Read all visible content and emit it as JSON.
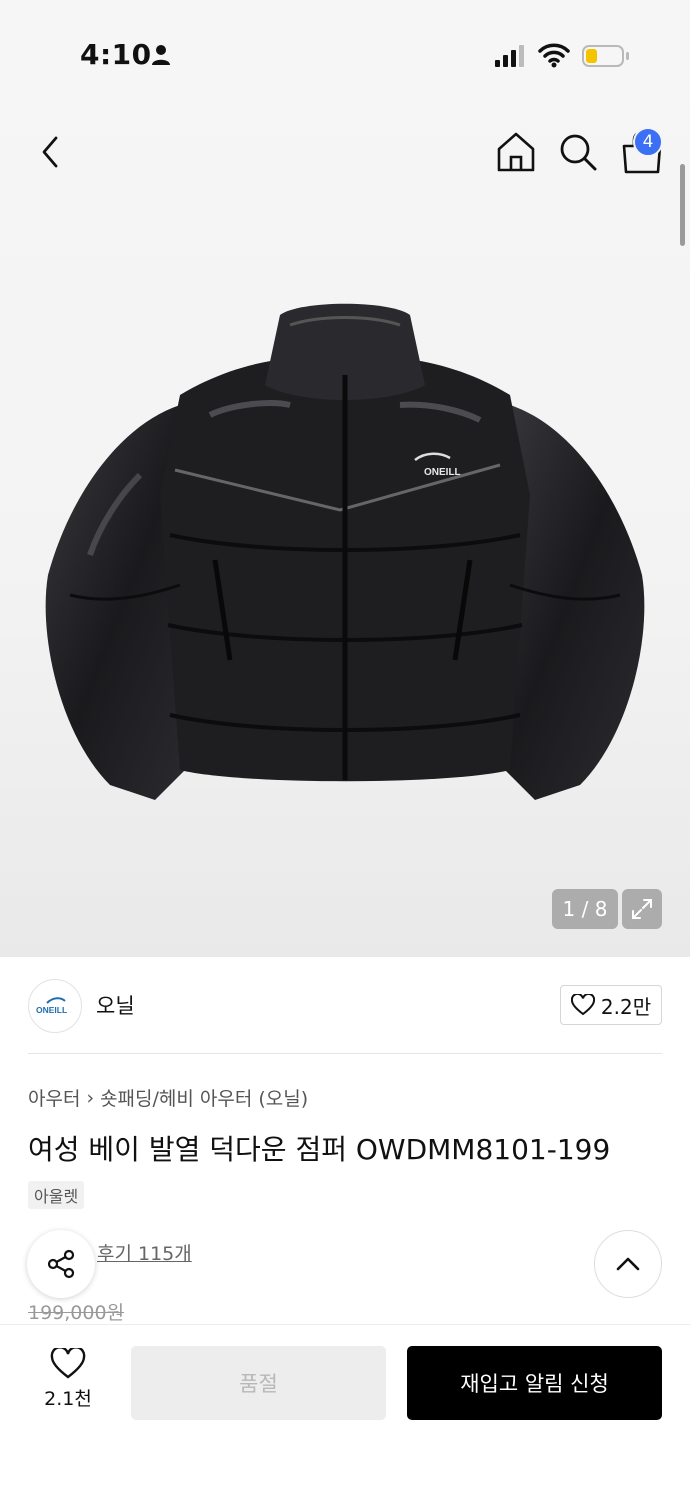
{
  "status_bar": {
    "time": "4:10",
    "icons": [
      "person-icon",
      "cellular-signal-icon",
      "wifi-icon",
      "battery-low-icon"
    ],
    "battery_color": "#f5c400"
  },
  "nav": {
    "icons": [
      "chevron-left-icon",
      "home-icon",
      "search-icon",
      "shopping-bag-icon"
    ],
    "cart_count": "4",
    "badge_color": "#3b6ff5"
  },
  "gallery": {
    "counter": "1 / 8",
    "logo_text": "ONEILL"
  },
  "brand": {
    "logo_text": "ONEILL",
    "name": "오닐",
    "likes": "2.2만"
  },
  "product": {
    "breadcrumb": [
      "아우터",
      "숏패딩/헤비 아우터 (오닐)"
    ],
    "title": "여성 베이 발열 덕다운 점퍼 OWDMM8101-199",
    "tag": "아울렛",
    "reviews": "후기 115개",
    "original_price": "199,000원"
  },
  "bottom_bar": {
    "wish_count": "2.1천",
    "soldout_label": "품절",
    "restock_label": "재입고 알림 신청"
  }
}
